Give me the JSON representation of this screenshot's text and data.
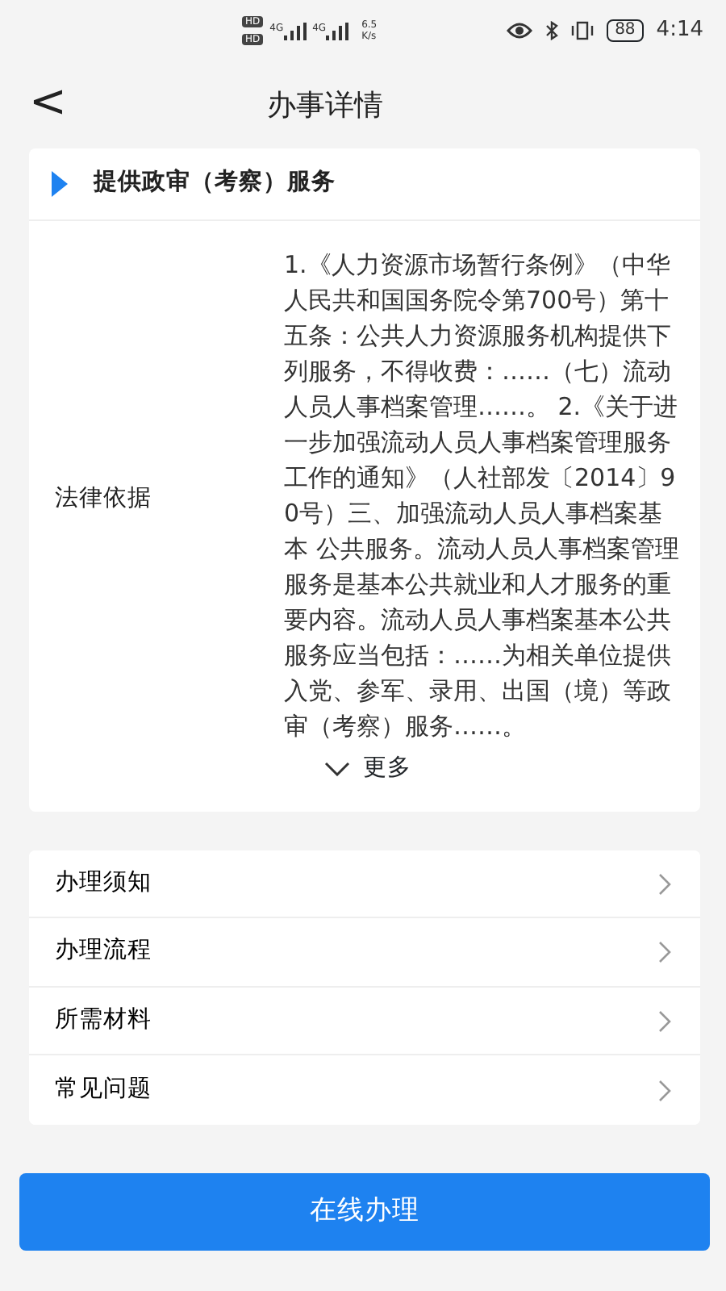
{
  "status_bar": {
    "sims": [
      {
        "badge": "HD",
        "network": "4G"
      },
      {
        "badge": "HD",
        "network": "4G"
      }
    ],
    "speed_value": "6.5",
    "speed_unit": "K/s",
    "battery": "88",
    "time": "4:14"
  },
  "header": {
    "back": "<",
    "title": "办事详情"
  },
  "service": {
    "title": "提供政审（考察）服务",
    "label": "法律依据",
    "text": "1.《人力资源市场暂行条例》（中华人民共和国国务院令第700号）第十五条：公共人力资源服务机构提供下列服务，不得收费：……（七）流动人员人事档案管理……。 2.《关于进一步加强流动人员人事档案管理服务工作的通知》（人社部发〔2014〕90号）三、加强流动人员人事档案基本 公共服务。流动人员人事档案管理服务是基本公共就业和人才服务的重要内容。流动人员人事档案基本公共服务应当包括：……为相关单位提供入党、参军、录用、出国（境）等政审（考察）服务……。",
    "more": "更多"
  },
  "menu": [
    {
      "label": "办理须知"
    },
    {
      "label": "办理流程"
    },
    {
      "label": "所需材料"
    },
    {
      "label": "常见问题"
    }
  ],
  "action": "在线办理"
}
